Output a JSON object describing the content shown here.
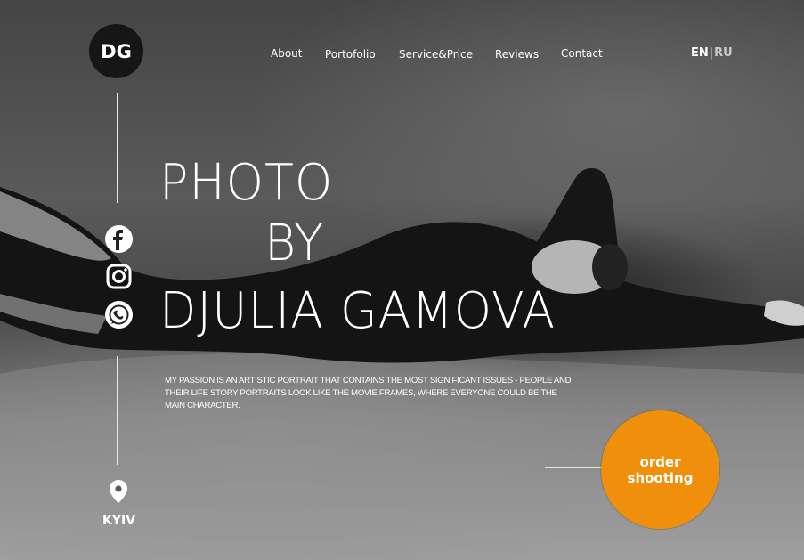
{
  "brand": {
    "logo_text": "DG"
  },
  "nav": {
    "items": [
      "About",
      "Portofolio",
      "Service&Price",
      "Reviews",
      "Contact"
    ]
  },
  "lang": {
    "active": "EN",
    "separator": "|",
    "other": "RU"
  },
  "hero": {
    "title_line1": "PHOTO",
    "title_line2": "BY",
    "title_line3": "DJULIA GAMOVA",
    "description": "MY PASSION IS AN ARTISTIC PORTRAIT THAT CONTAINS THE MOST SIGNIFICANT ISSUES - PEOPLE AND THEIR LIFE STORY PORTRAITS LOOK LIKE THE MOVIE FRAMES, WHERE EVERYONE COULD BE THE MAIN CHARACTER."
  },
  "cta": {
    "line1": "order",
    "line2": "shooting",
    "color": "#ef8f0b"
  },
  "social": [
    "facebook-icon",
    "instagram-icon",
    "whatsapp-icon"
  ],
  "location": {
    "city": "KYIV"
  }
}
